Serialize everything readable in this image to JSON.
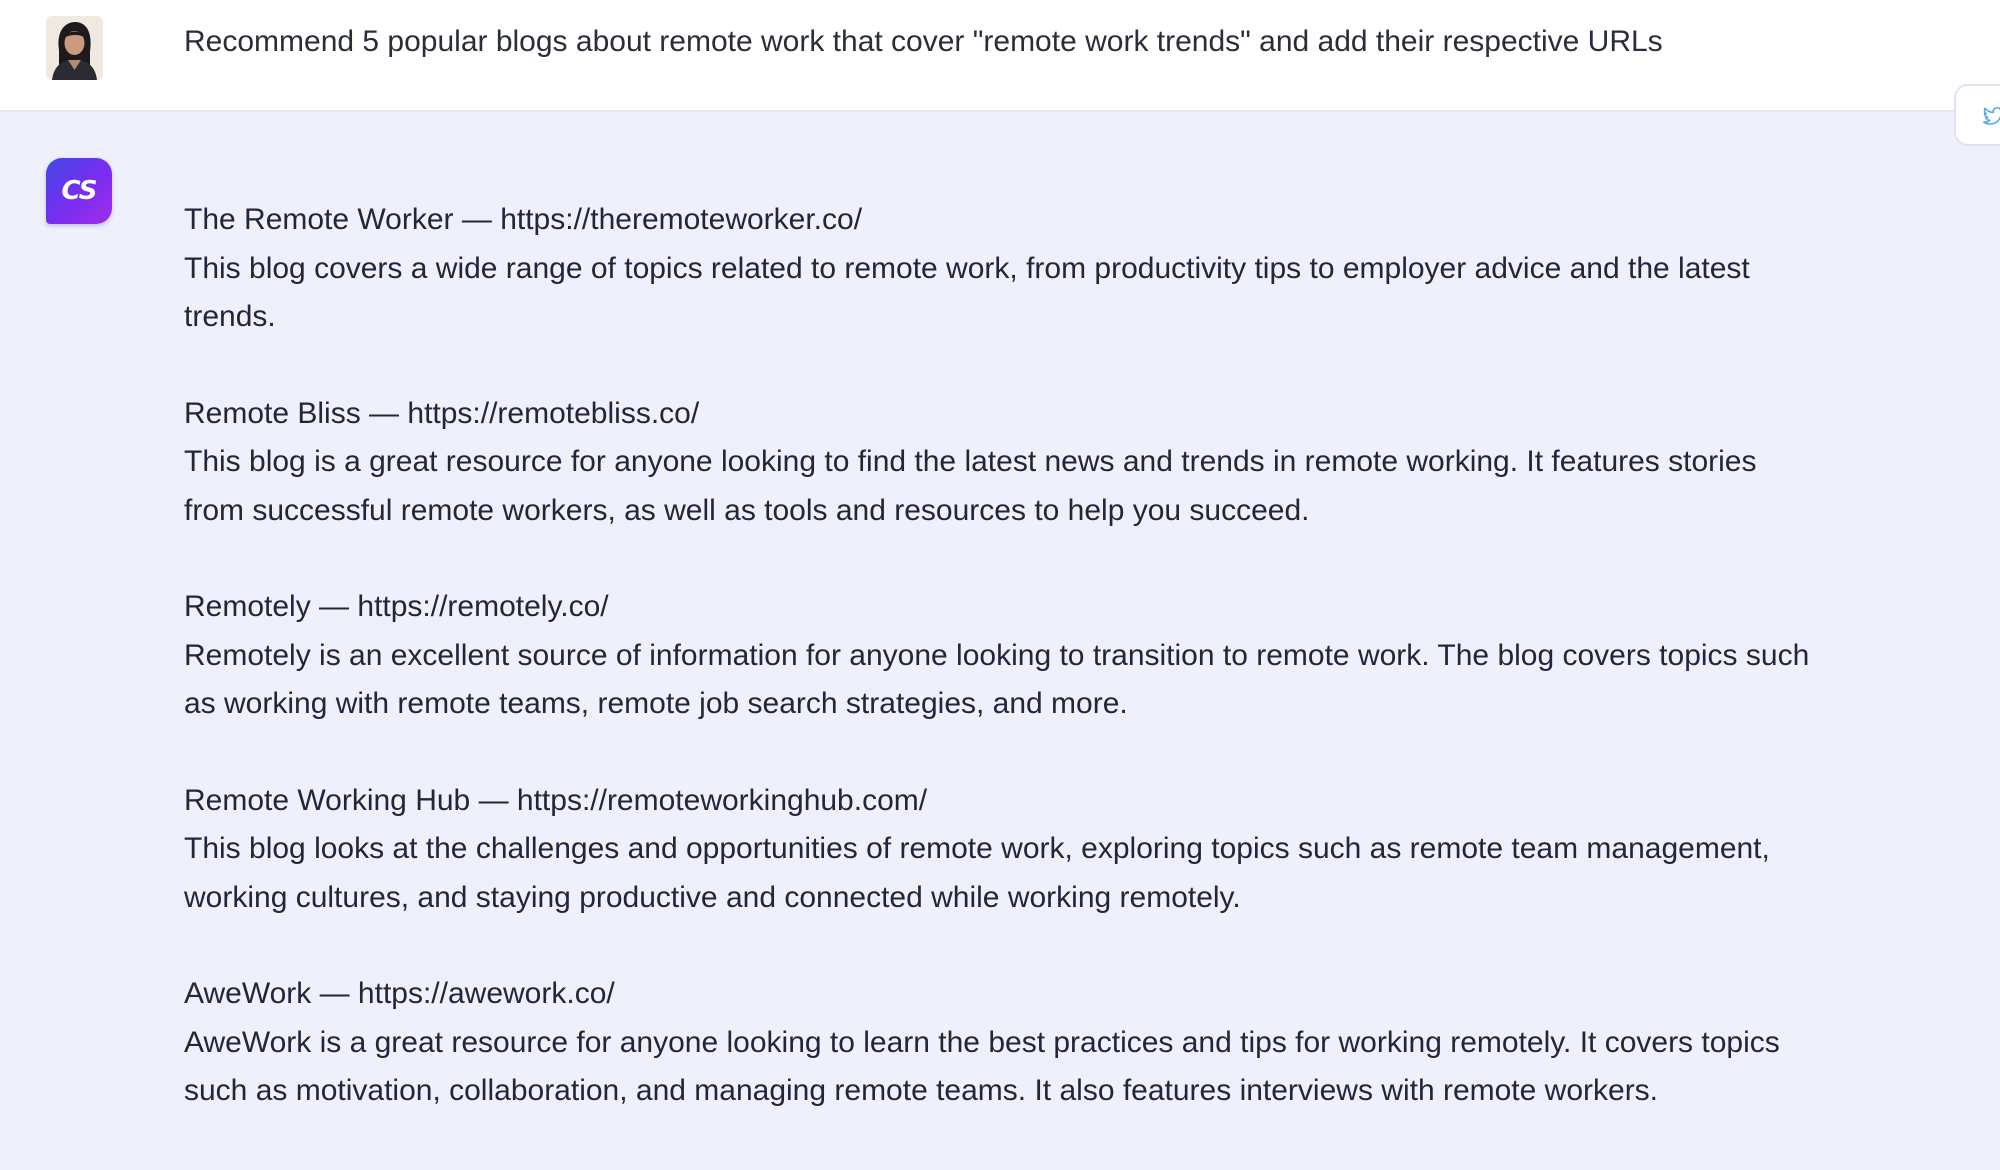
{
  "user_message": {
    "text": "Recommend 5 popular blogs about remote work that cover \"remote work trends\" and add their respective URLs"
  },
  "assistant": {
    "logo_text": "CS",
    "blogs": [
      {
        "header": "The Remote Worker — https://theremoteworker.co/",
        "description": "This blog covers a wide range of topics related to remote work, from productivity tips to employer advice and the latest trends."
      },
      {
        "header": "Remote Bliss — https://remotebliss.co/",
        "description": "This blog is a great resource for anyone looking to find the latest news and trends in remote working. It features stories from successful remote workers, as well as tools and resources to help you succeed."
      },
      {
        "header": "Remotely — https://remotely.co/",
        "description": "Remotely is an excellent source of information for anyone looking to transition to remote work. The blog covers topics such as working with remote teams, remote job search strategies, and more."
      },
      {
        "header": "Remote Working Hub — https://remoteworkinghub.com/",
        "description": "This blog looks at the challenges and opportunities of remote work, exploring topics such as remote team management, working cultures, and staying productive and connected while working remotely."
      },
      {
        "header": "AweWork — https://awework.co/",
        "description": "AweWork is a great resource for anyone looking to learn the best practices and tips for working remotely. It covers topics such as motivation, collaboration, and managing remote teams. It also features interviews with remote workers."
      }
    ]
  },
  "icons": {
    "user_avatar": "user-avatar-photo",
    "assistant_logo": "assistant-logo-icon",
    "side_tab": "twitter-icon"
  },
  "colors": {
    "assistant_background": "#eef0fb",
    "user_background": "#ffffff",
    "logo_gradient_start": "#3f48e6",
    "logo_gradient_end": "#a12ee8"
  }
}
